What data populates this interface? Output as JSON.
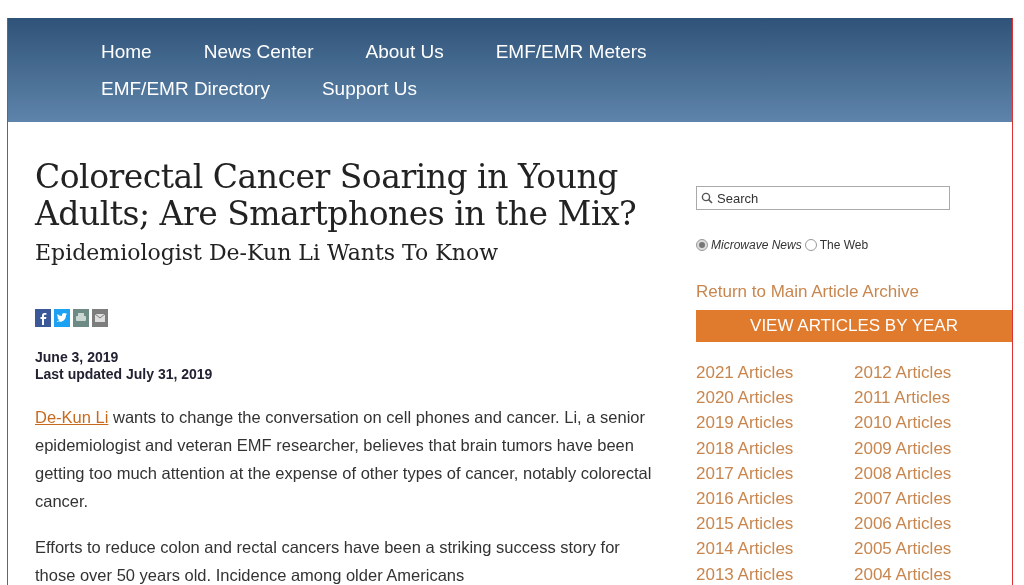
{
  "nav": {
    "items": [
      {
        "label": "Home"
      },
      {
        "label": "News Center"
      },
      {
        "label": "About Us"
      },
      {
        "label": "EMF/EMR Meters"
      },
      {
        "label": "EMF/EMR Directory"
      },
      {
        "label": "Support Us"
      }
    ]
  },
  "article": {
    "title": "Colorectal Cancer Soaring in Young Adults; Are Smartphones in the Mix?",
    "subtitle": "Epidemiologist De-Kun Li Wants To Know",
    "share": [
      {
        "kind": "facebook"
      },
      {
        "kind": "twitter"
      },
      {
        "kind": "print"
      },
      {
        "kind": "email"
      }
    ],
    "date": "June 3, 2019",
    "updated": "Last updated July 31, 2019",
    "paragraphs": [
      {
        "link": "De-Kun Li",
        "text": " wants to change the conversation on cell phones and cancer. Li, a senior epidemiologist and veteran EMF researcher, believes that brain tumors have been getting too much attention at the expense of other types of cancer, notably colorectal cancer."
      },
      {
        "text": "Efforts to reduce colon and rectal cancers have been a striking success story for those over 50 years old. Incidence among older Americans"
      }
    ]
  },
  "sidebar": {
    "search": {
      "placeholder": "Search"
    },
    "scope": [
      {
        "label": "Microwave News",
        "selected": true
      },
      {
        "label": "The Web",
        "selected": false
      }
    ],
    "archive_link": "Return to Main Article Archive",
    "year_header": "VIEW ARTICLES BY YEAR",
    "year_columns": [
      [
        "2021 Articles",
        "2020 Articles",
        "2019 Articles",
        "2018 Articles",
        "2017 Articles",
        "2016 Articles",
        "2015 Articles",
        "2014 Articles",
        "2013 Articles"
      ],
      [
        "2012 Articles",
        "2011 Articles",
        "2010 Articles",
        "2009 Articles",
        "2008 Articles",
        "2007 Articles",
        "2006 Articles",
        "2005 Articles",
        "2004 Articles"
      ]
    ]
  }
}
